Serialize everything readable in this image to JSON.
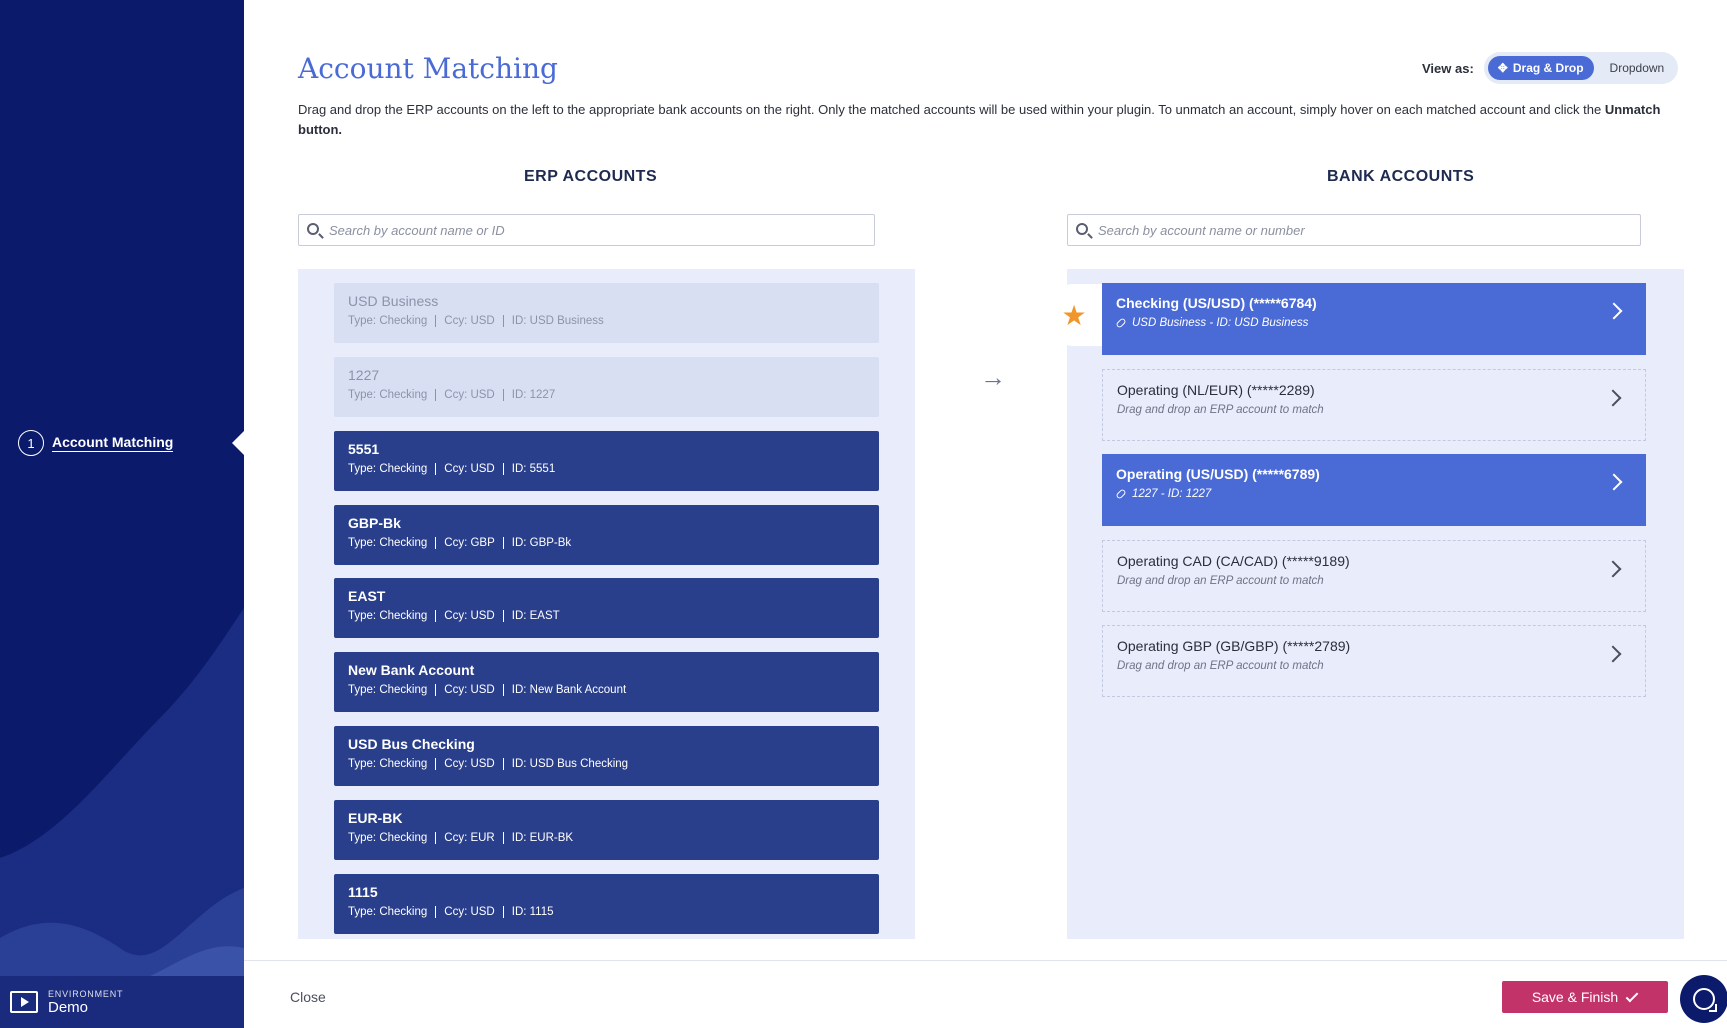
{
  "sidebar": {
    "step_number": "1",
    "step_label": "Account Matching",
    "environment_label": "ENVIRONMENT",
    "environment_value": "Demo"
  },
  "header": {
    "title": "Account Matching",
    "view_as_label": "View as:",
    "view_options": [
      "Drag & Drop",
      "Dropdown"
    ],
    "selected_view": "Drag & Drop",
    "description": "Drag and drop the ERP accounts on the left to the appropriate bank accounts on the right. Only the matched accounts will be used within your plugin. To unmatch an account, simply hover on each matched account and click the",
    "description_bold": "Unmatch button."
  },
  "erp": {
    "heading": "ERP ACCOUNTS",
    "search_placeholder": "Search by account name or ID",
    "items": [
      {
        "name": "USD Business",
        "type": "Type: Checking",
        "ccy": "Ccy: USD",
        "id": "ID: USD Business",
        "matched": true
      },
      {
        "name": "1227",
        "type": "Type: Checking",
        "ccy": "Ccy: USD",
        "id": "ID: 1227",
        "matched": true
      },
      {
        "name": "5551",
        "type": "Type: Checking",
        "ccy": "Ccy: USD",
        "id": "ID: 5551",
        "matched": false
      },
      {
        "name": "GBP-Bk",
        "type": "Type: Checking",
        "ccy": "Ccy: GBP",
        "id": "ID: GBP-Bk",
        "matched": false
      },
      {
        "name": "EAST",
        "type": "Type: Checking",
        "ccy": "Ccy: USD",
        "id": "ID: EAST",
        "matched": false
      },
      {
        "name": "New Bank Account",
        "type": "Type: Checking",
        "ccy": "Ccy: USD",
        "id": "ID: New Bank Account",
        "matched": false
      },
      {
        "name": "USD Bus Checking",
        "type": "Type: Checking",
        "ccy": "Ccy: USD",
        "id": "ID: USD Bus Checking",
        "matched": false
      },
      {
        "name": "EUR-BK",
        "type": "Type: Checking",
        "ccy": "Ccy: EUR",
        "id": "ID: EUR-BK",
        "matched": false
      },
      {
        "name": "1115",
        "type": "Type: Checking",
        "ccy": "Ccy: USD",
        "id": "ID: 1115",
        "matched": false
      }
    ]
  },
  "bank": {
    "heading": "BANK ACCOUNTS",
    "search_placeholder": "Search by account name or number",
    "items": [
      {
        "name": "Checking (US/USD) (*****6784)",
        "sub": "USD Business - ID: USD Business",
        "matched": true,
        "starred": true
      },
      {
        "name": "Operating (NL/EUR) (*****2289)",
        "sub": "Drag and drop an ERP account to match",
        "matched": false
      },
      {
        "name": "Operating (US/USD) (*****6789)",
        "sub": "1227 - ID: 1227",
        "matched": true
      },
      {
        "name": "Operating CAD (CA/CAD) (*****9189)",
        "sub": "Drag and drop an ERP account to match",
        "matched": false
      },
      {
        "name": "Operating GBP (GB/GBP) (*****2789)",
        "sub": "Drag and drop an ERP account to match",
        "matched": false
      }
    ]
  },
  "footer": {
    "close_label": "Close",
    "save_label": "Save & Finish"
  },
  "colors": {
    "sidebar_bg": "#0b1a6b",
    "accent": "#4a6ad6",
    "erp_item_bg": "#2a3f8c",
    "save_bg": "#c2336a",
    "star": "#f0962a"
  },
  "icons": [
    "search-icon",
    "arrow-right-icon",
    "star-icon",
    "chevron-right-icon",
    "link-icon",
    "move-icon",
    "check-icon",
    "chat-icon",
    "monitor-play-icon"
  ]
}
